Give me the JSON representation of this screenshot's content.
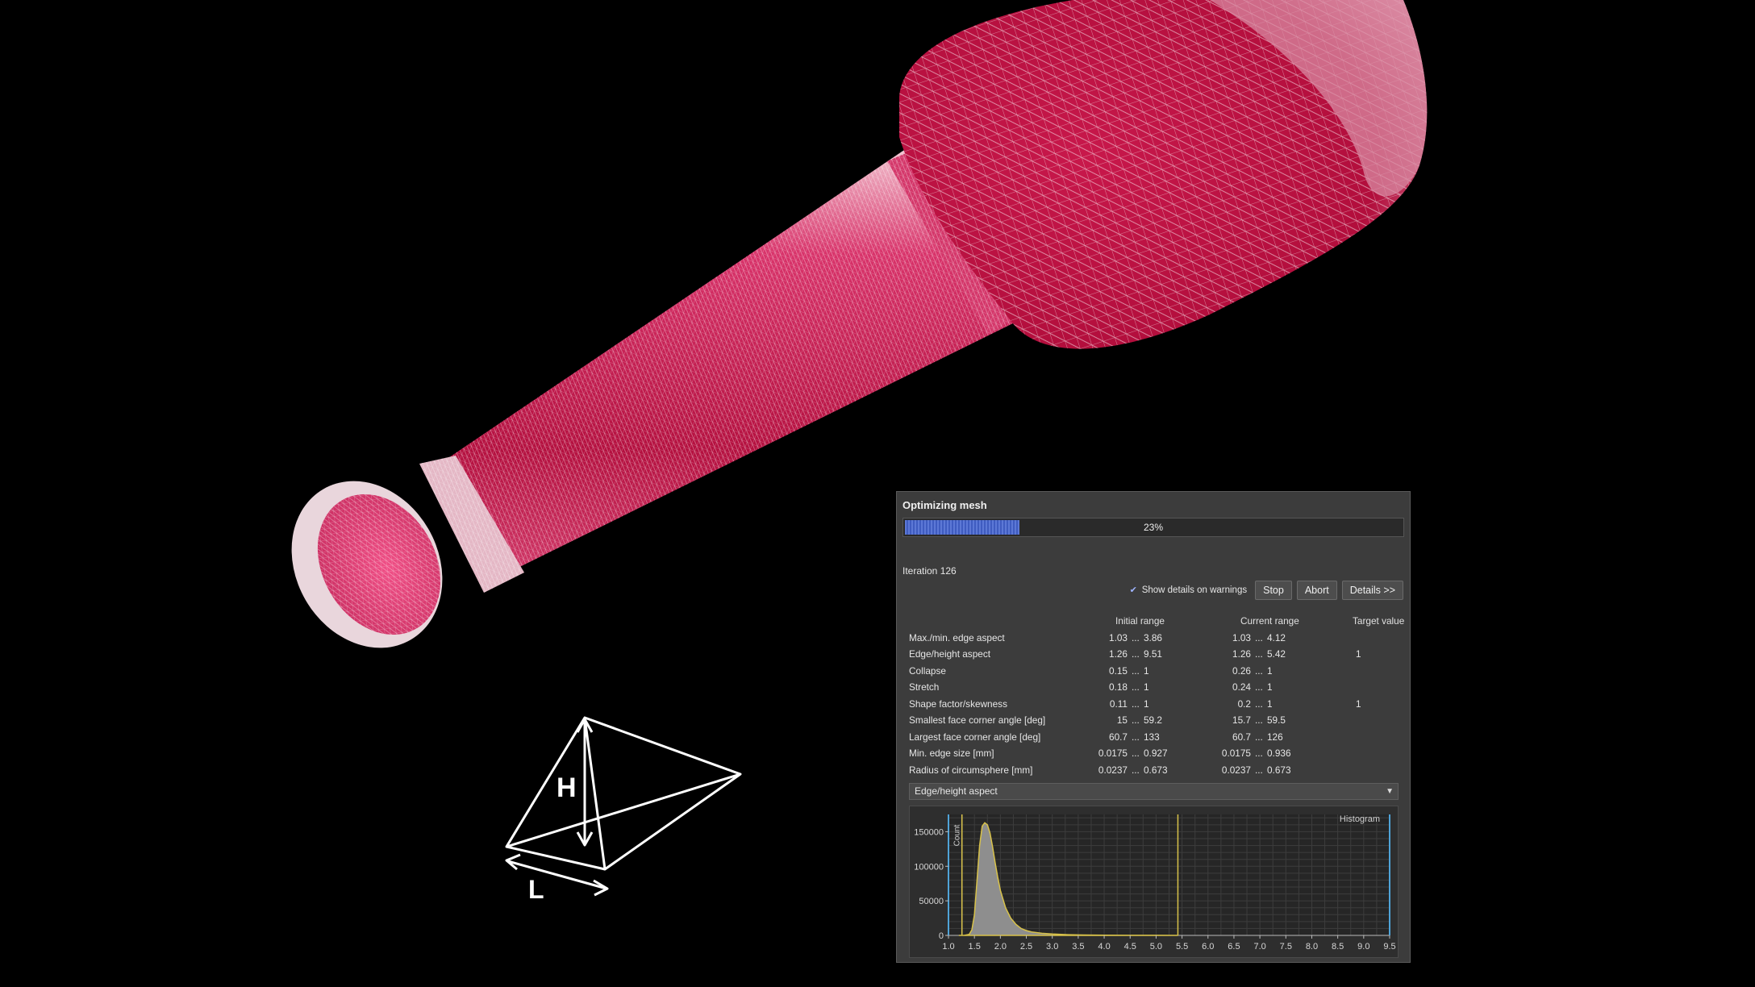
{
  "dialog": {
    "title": "Optimizing mesh",
    "progress": {
      "percent": 23,
      "label": "23%"
    },
    "iteration_label": "Iteration 126",
    "checkbox": {
      "label": "Show details on warnings",
      "checked": true
    },
    "buttons": {
      "stop": "Stop",
      "abort": "Abort",
      "details": "Details >>"
    },
    "table": {
      "headers": {
        "initial": "Initial range",
        "current": "Current range",
        "target": "Target value"
      },
      "range_sep": "...",
      "rows": [
        {
          "label": "Max./min. edge aspect",
          "i0": "1.03",
          "i1": "3.86",
          "c0": "1.03",
          "c1": "4.12",
          "t": ""
        },
        {
          "label": "Edge/height aspect",
          "i0": "1.26",
          "i1": "9.51",
          "c0": "1.26",
          "c1": "5.42",
          "t": "1"
        },
        {
          "label": "Collapse",
          "i0": "0.15",
          "i1": "1",
          "c0": "0.26",
          "c1": "1",
          "t": ""
        },
        {
          "label": "Stretch",
          "i0": "0.18",
          "i1": "1",
          "c0": "0.24",
          "c1": "1",
          "t": ""
        },
        {
          "label": "Shape factor/skewness",
          "i0": "0.11",
          "i1": "1",
          "c0": "0.2",
          "c1": "1",
          "t": "1"
        },
        {
          "label": "Smallest face corner angle [deg]",
          "i0": "15",
          "i1": "59.2",
          "c0": "15.7",
          "c1": "59.5",
          "t": ""
        },
        {
          "label": "Largest face corner angle [deg]",
          "i0": "60.7",
          "i1": "133",
          "c0": "60.7",
          "c1": "126",
          "t": ""
        },
        {
          "label": "Min. edge size [mm]",
          "i0": "0.0175",
          "i1": "0.927",
          "c0": "0.0175",
          "c1": "0.936",
          "t": ""
        },
        {
          "label": "Radius of circumsphere [mm]",
          "i0": "0.0237",
          "i1": "0.673",
          "c0": "0.0237",
          "c1": "0.673",
          "t": ""
        }
      ]
    },
    "select": {
      "value": "Edge/height aspect"
    }
  },
  "chart_data": {
    "type": "area",
    "title": "Histogram",
    "ylabel": "Count",
    "xlabel": "",
    "xlim": [
      1.0,
      9.5
    ],
    "ylim": [
      0,
      175000
    ],
    "x_ticks": [
      "1.0",
      "1.5",
      "2.0",
      "2.5",
      "3.0",
      "3.5",
      "4.0",
      "4.5",
      "5.0",
      "5.5",
      "6.0",
      "6.5",
      "7.0",
      "7.5",
      "8.0",
      "8.5",
      "9.0",
      "9.5"
    ],
    "y_ticks": [
      0,
      50000,
      100000,
      150000
    ],
    "y_tick_labels": [
      "0",
      "50000",
      "100000",
      "150000"
    ],
    "grid": true,
    "series": [
      {
        "x": [
          1.2,
          1.3,
          1.4,
          1.45,
          1.5,
          1.55,
          1.6,
          1.65,
          1.7,
          1.75,
          1.8,
          1.85,
          1.9,
          1.95,
          2.0,
          2.1,
          2.2,
          2.3,
          2.4,
          2.5,
          2.6,
          2.8,
          3.0,
          3.3,
          3.6,
          4.0,
          4.5,
          5.0,
          5.42
        ],
        "y": [
          0,
          0,
          1500,
          8000,
          30000,
          80000,
          130000,
          158000,
          163000,
          160000,
          148000,
          128000,
          105000,
          84000,
          65000,
          40000,
          25000,
          16000,
          10000,
          7000,
          5000,
          3000,
          2000,
          1000,
          600,
          300,
          150,
          60,
          0
        ]
      }
    ],
    "markers": [
      {
        "name": "Count",
        "x": 1.26
      },
      {
        "name": "",
        "x": 5.42
      }
    ],
    "colors": {
      "fill": "#8e8e8e",
      "outline": "#d8c24a",
      "marker": "#d8c24a",
      "edge_marker": "#4fa3d8"
    }
  }
}
